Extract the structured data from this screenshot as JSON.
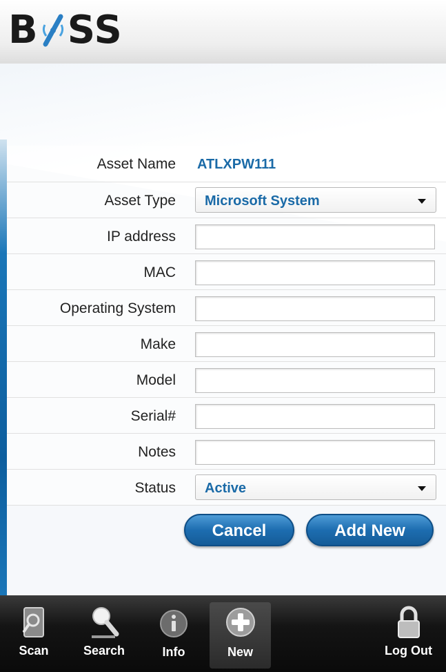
{
  "app": {
    "logo_left": "B",
    "logo_right": "SS"
  },
  "form": {
    "asset_name_label": "Asset Name",
    "asset_name_value": "ATLXPW111",
    "asset_type_label": "Asset Type",
    "asset_type_value": "Microsoft System",
    "ip_label": "IP address",
    "ip_value": "",
    "mac_label": "MAC",
    "mac_value": "",
    "os_label": "Operating System",
    "os_value": "",
    "make_label": "Make",
    "make_value": "",
    "model_label": "Model",
    "model_value": "",
    "serial_label": "Serial#",
    "serial_value": "",
    "notes_label": "Notes",
    "notes_value": "",
    "status_label": "Status",
    "status_value": "Active"
  },
  "actions": {
    "cancel_label": "Cancel",
    "add_label": "Add New"
  },
  "tabs": [
    {
      "label": "Scan",
      "icon": "scan-icon"
    },
    {
      "label": "Search",
      "icon": "search-icon"
    },
    {
      "label": "Info",
      "icon": "info-icon"
    },
    {
      "label": "New",
      "icon": "plus-icon",
      "active": true
    },
    {
      "label": "Log Out",
      "icon": "lock-icon"
    }
  ],
  "colors": {
    "accent": "#1a6aa7",
    "button": "#1d6db0",
    "tabbar": "#141414"
  }
}
